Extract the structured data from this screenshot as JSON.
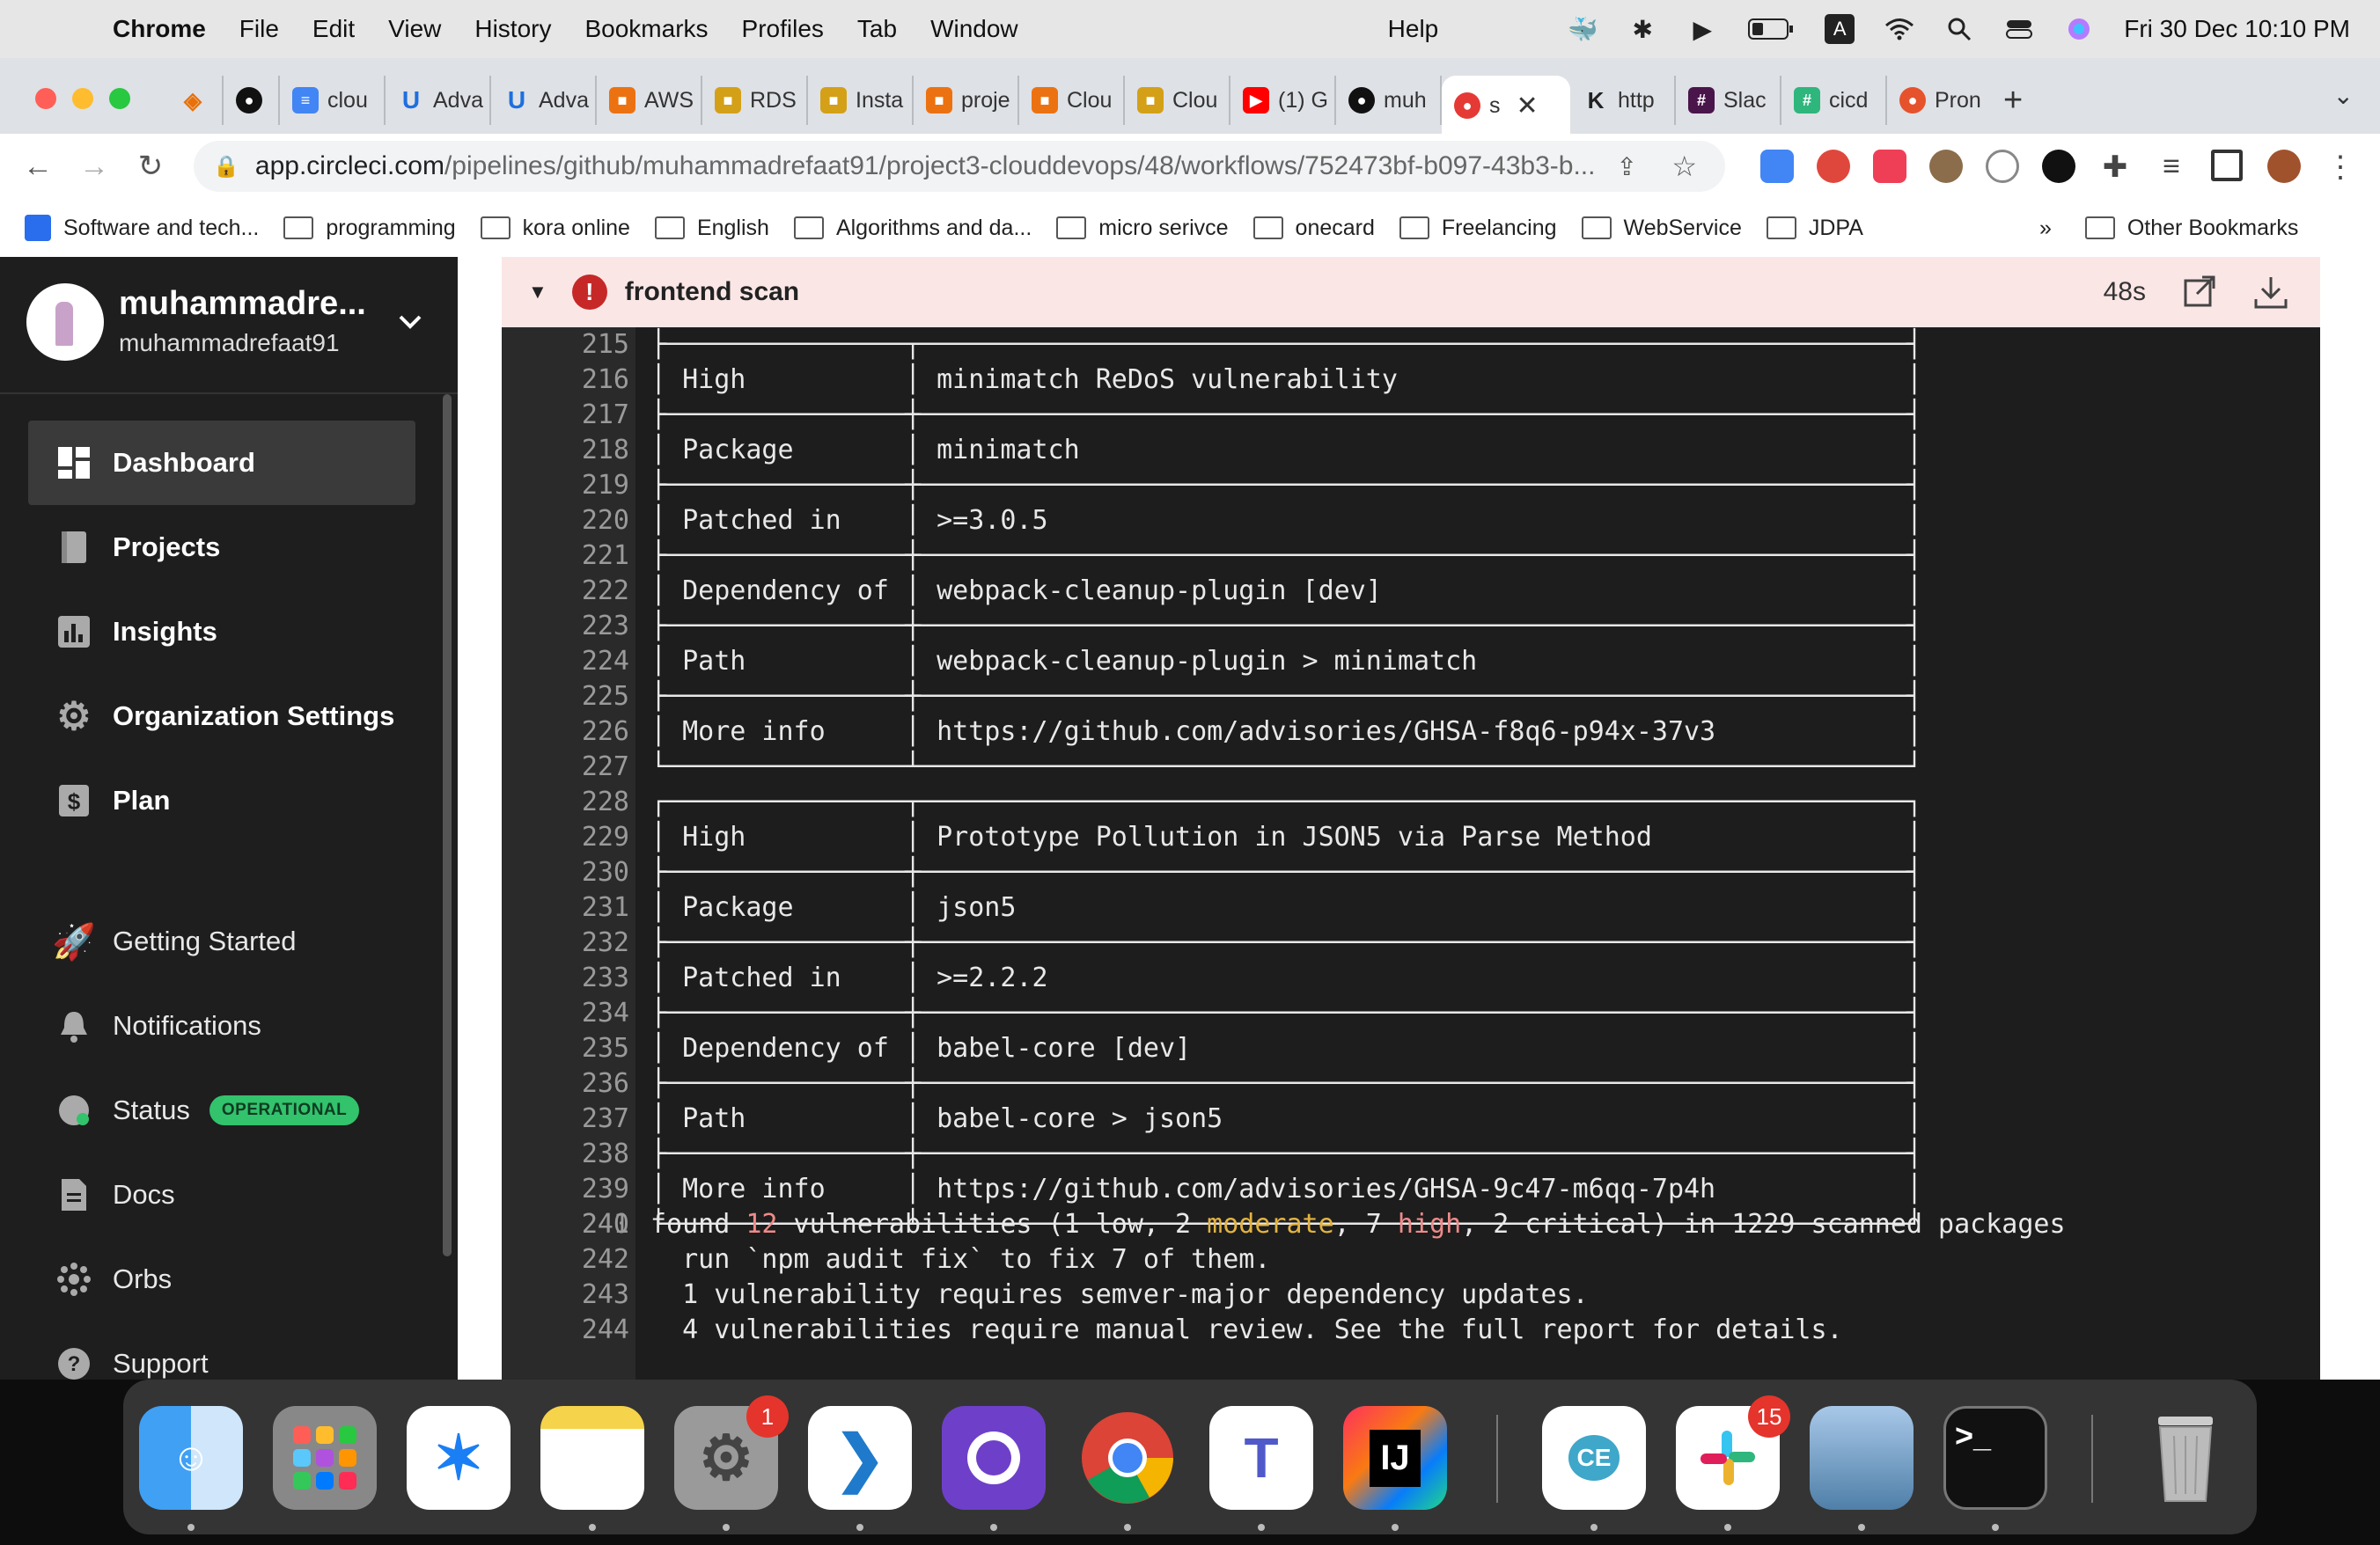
{
  "menubar": {
    "app": "Chrome",
    "items": [
      "File",
      "Edit",
      "View",
      "History",
      "Bookmarks",
      "Profiles",
      "Tab",
      "Window"
    ],
    "help": "Help",
    "clock": "Fri 30 Dec  10:10 PM",
    "keyboard_indicator": "A"
  },
  "tabs": [
    "clou",
    "Adva",
    "Adva",
    "AWS",
    "RDS",
    "Insta",
    "proje",
    "Clou",
    "Clou",
    "(1) G",
    "muh",
    "s",
    "http",
    "Slac",
    "cicd",
    "Pron"
  ],
  "address": {
    "host": "app.circleci.com",
    "path": "/pipelines/github/muhammadrefaat91/project3-clouddevops/48/workflows/752473bf-b097-43b3-b..."
  },
  "bookmarks": [
    "Software and tech...",
    "programming",
    "kora online",
    "English",
    "Algorithms and da...",
    "micro serivce",
    "onecard",
    "Freelancing",
    "WebService",
    "JDPA"
  ],
  "bookmarks_more": "»",
  "bookmarks_other": "Other Bookmarks",
  "sidebar": {
    "profile_name": "muhammadre...",
    "profile_handle": "muhammadrefaat91",
    "nav": [
      "Dashboard",
      "Projects",
      "Insights",
      "Organization Settings",
      "Plan"
    ],
    "secondary": [
      "Getting Started",
      "Notifications",
      "Status",
      "Docs",
      "Orbs",
      "Support"
    ],
    "status_badge": "OPERATIONAL"
  },
  "step": {
    "title": "frontend scan",
    "duration": "48s"
  },
  "log": [
    {
      "n": "215",
      "t": "├───────────────┬──────────────────────────────────────────────────────────────┤"
    },
    {
      "n": "216",
      "t": "│ High          │ minimatch ReDoS vulnerability                                │"
    },
    {
      "n": "217",
      "t": "├───────────────┼──────────────────────────────────────────────────────────────┤"
    },
    {
      "n": "218",
      "t": "│ Package       │ minimatch                                                    │"
    },
    {
      "n": "219",
      "t": "├───────────────┼──────────────────────────────────────────────────────────────┤"
    },
    {
      "n": "220",
      "t": "│ Patched in    │ >=3.0.5                                                      │"
    },
    {
      "n": "221",
      "t": "├───────────────┼──────────────────────────────────────────────────────────────┤"
    },
    {
      "n": "222",
      "t": "│ Dependency of │ webpack-cleanup-plugin [dev]                                 │"
    },
    {
      "n": "223",
      "t": "├───────────────┼──────────────────────────────────────────────────────────────┤"
    },
    {
      "n": "224",
      "t": "│ Path          │ webpack-cleanup-plugin > minimatch                           │"
    },
    {
      "n": "225",
      "t": "├───────────────┼──────────────────────────────────────────────────────────────┤"
    },
    {
      "n": "226",
      "t": "│ More info     │ https://github.com/advisories/GHSA-f8q6-p94x-37v3            │"
    },
    {
      "n": "227",
      "t": "└───────────────┴──────────────────────────────────────────────────────────────┘"
    },
    {
      "n": "228",
      "t": "┌───────────────┬──────────────────────────────────────────────────────────────┐"
    },
    {
      "n": "229",
      "t": "│ High          │ Prototype Pollution in JSON5 via Parse Method                │"
    },
    {
      "n": "230",
      "t": "├───────────────┼──────────────────────────────────────────────────────────────┤"
    },
    {
      "n": "231",
      "t": "│ Package       │ json5                                                        │"
    },
    {
      "n": "232",
      "t": "├───────────────┼──────────────────────────────────────────────────────────────┤"
    },
    {
      "n": "233",
      "t": "│ Patched in    │ >=2.2.2                                                      │"
    },
    {
      "n": "234",
      "t": "├───────────────┼──────────────────────────────────────────────────────────────┤"
    },
    {
      "n": "235",
      "t": "│ Dependency of │ babel-core [dev]                                             │"
    },
    {
      "n": "236",
      "t": "├───────────────┼──────────────────────────────────────────────────────────────┤"
    },
    {
      "n": "237",
      "t": "│ Path          │ babel-core > json5                                           │"
    },
    {
      "n": "238",
      "t": "├───────────────┼──────────────────────────────────────────────────────────────┤"
    },
    {
      "n": "239",
      "t": "│ More info     │ https://github.com/advisories/GHSA-9c47-m6qq-7p4h            │"
    },
    {
      "n": "240",
      "t": "└───────────────┴──────────────────────────────────────────────────────────────┘"
    }
  ],
  "summary": {
    "n241": "241",
    "found": "found ",
    "count": "12",
    "vuln": " vulnerabilities (1 low, 2 ",
    "moderate": "moderate",
    "mid": ", 7 ",
    "high": "high",
    "rest": ", 2 critical) in 1229 scanned packages",
    "n242": "242",
    "l242": "  run `npm audit fix` to fix 7 of them.",
    "n243": "243",
    "l243": "  1 vulnerability requires semver-major dependency updates.",
    "n244": "244",
    "l244": "  4 vulnerabilities require manual review. See the full report for details."
  },
  "dock": {
    "settings_badge": "1",
    "slack_badge": "15",
    "intellij_label": "IJ",
    "dbeaver_label": "CE",
    "terminal_label": ">_"
  },
  "colors": {
    "sidebar": "#1e1e1e",
    "active_nav": "#3a3a3a",
    "status_green": "#32c36c",
    "error_red": "#c62828",
    "step_bg": "#fbe6e6",
    "terminal_bg": "#1d1d1d"
  }
}
